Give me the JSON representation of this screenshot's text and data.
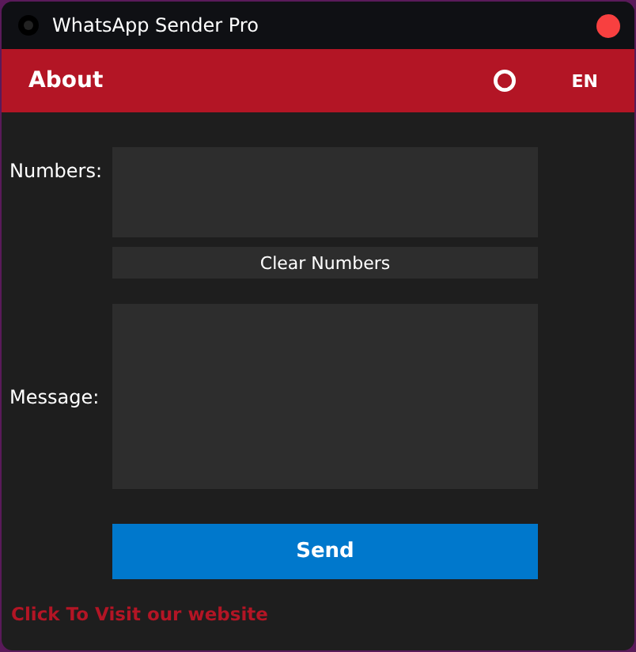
{
  "window": {
    "title": "WhatsApp Sender Pro"
  },
  "header": {
    "title": "About",
    "language": "EN"
  },
  "numbers": {
    "label": "Numbers:"
  },
  "clear_button": "Clear Numbers",
  "message": {
    "label": "Message:"
  },
  "send_button": "Send",
  "website_link": "Click To Visit our website"
}
